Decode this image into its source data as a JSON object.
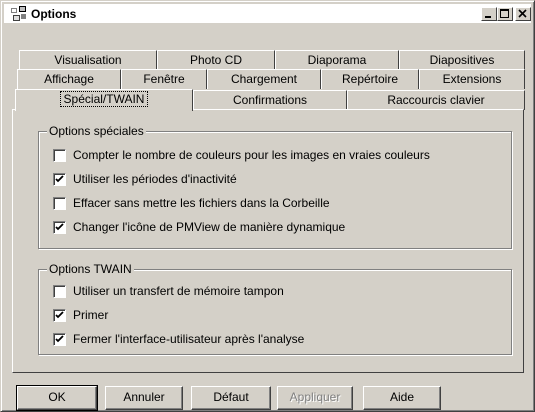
{
  "window": {
    "title": "Options",
    "icon": "pmview-app-icon",
    "controls": [
      "minimize-icon",
      "maximize-icon",
      "close-icon"
    ]
  },
  "tabs": {
    "row1": [
      "Visualisation",
      "Photo CD",
      "Diaporama",
      "Diapositives"
    ],
    "row2": [
      "Affichage",
      "Fenêtre",
      "Chargement",
      "Repértoire",
      "Extensions"
    ],
    "row3": [
      "Spécial/TWAIN",
      "Confirmations",
      "Raccourcis clavier"
    ],
    "active": "Spécial/TWAIN"
  },
  "special": {
    "label": "Options spéciales",
    "items": [
      {
        "label": "Compter le nombre de couleurs pour les images en vraies couleurs",
        "checked": false
      },
      {
        "label": "Utiliser les périodes d'inactivité",
        "checked": true
      },
      {
        "label": "Effacer sans mettre les fichiers dans la Corbeille",
        "checked": false
      },
      {
        "label": "Changer l'icône de PMView de manière dynamique",
        "checked": true
      }
    ]
  },
  "twain": {
    "label": "Options TWAIN",
    "items": [
      {
        "label": "Utiliser un transfert de mémoire tampon",
        "checked": false
      },
      {
        "label": "Primer",
        "checked": true
      },
      {
        "label": "Fermer l'interface-utilisateur après l'analyse",
        "checked": true
      }
    ]
  },
  "buttons": {
    "ok": "OK",
    "cancel": "Annuler",
    "default": "Défaut",
    "apply": "Appliquer",
    "help": "Aide"
  }
}
